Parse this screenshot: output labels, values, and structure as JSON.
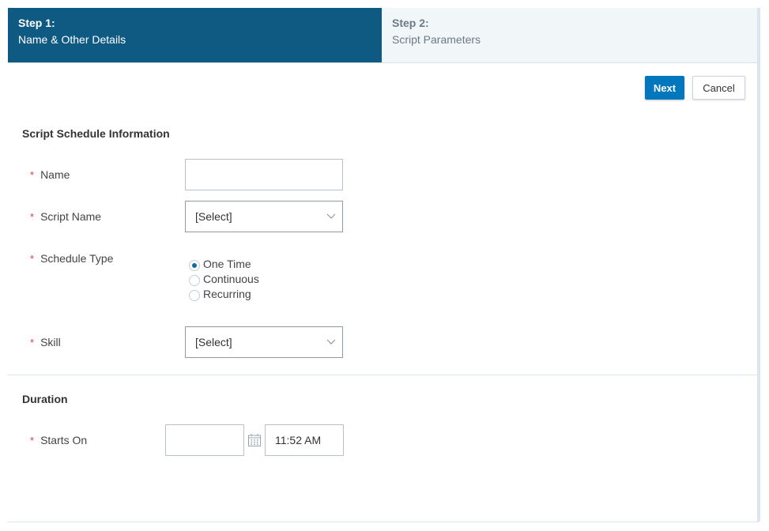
{
  "wizard": {
    "steps": [
      {
        "number": "Step 1:",
        "label": "Name & Other Details",
        "active": true
      },
      {
        "number": "Step 2:",
        "label": "Script Parameters",
        "active": false
      }
    ]
  },
  "toolbar": {
    "next_label": "Next",
    "cancel_label": "Cancel"
  },
  "colors": {
    "active_step": "#0f5a82",
    "primary_button": "#0277bd",
    "required_marker": "#e0403c"
  },
  "schedule_section": {
    "title": "Script Schedule Information",
    "required_marker": "*",
    "name": {
      "label": "Name",
      "value": ""
    },
    "script_name": {
      "label": "Script Name",
      "value": "[Select]"
    },
    "schedule_type": {
      "label": "Schedule Type",
      "options": [
        {
          "label": "One Time",
          "selected": true
        },
        {
          "label": "Continuous",
          "selected": false
        },
        {
          "label": "Recurring",
          "selected": false
        }
      ]
    },
    "skill": {
      "label": "Skill",
      "value": "[Select]"
    }
  },
  "duration_section": {
    "title": "Duration",
    "starts_on": {
      "label": "Starts On",
      "date_value": "",
      "time_value": "11:52 AM",
      "calendar_icon": "calendar-icon"
    }
  }
}
